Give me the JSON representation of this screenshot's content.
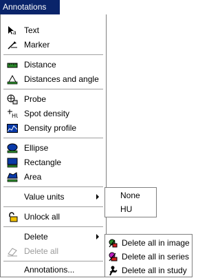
{
  "menubar": {
    "title": "Annotations"
  },
  "menu": {
    "items": [
      {
        "label": "Text",
        "icon": "text-cursor-icon"
      },
      {
        "label": "Marker",
        "icon": "marker-icon"
      },
      {
        "label": "Distance",
        "icon": "ruler-icon"
      },
      {
        "label": "Distances and angle",
        "icon": "angle-icon"
      },
      {
        "label": "Probe",
        "icon": "probe-icon"
      },
      {
        "label": "Spot density",
        "icon": "spot-density-icon"
      },
      {
        "label": "Density profile",
        "icon": "density-profile-icon"
      },
      {
        "label": "Ellipse",
        "icon": "ellipse-icon"
      },
      {
        "label": "Rectangle",
        "icon": "rectangle-icon"
      },
      {
        "label": "Area",
        "icon": "area-icon"
      },
      {
        "label": "Value units"
      },
      {
        "label": "Unlock all",
        "icon": "lock-icon"
      },
      {
        "label": "Delete"
      },
      {
        "label": "Delete all",
        "icon": "eraser-icon"
      },
      {
        "label": "Annotations..."
      }
    ]
  },
  "value_units_submenu": {
    "items": [
      "None",
      "HU"
    ]
  },
  "delete_submenu": {
    "items": [
      {
        "label": "Delete all in image",
        "icon": "delete-image-icon"
      },
      {
        "label": "Delete all in series",
        "icon": "delete-series-icon"
      },
      {
        "label": "Delete all in study",
        "icon": "delete-study-icon"
      }
    ]
  }
}
